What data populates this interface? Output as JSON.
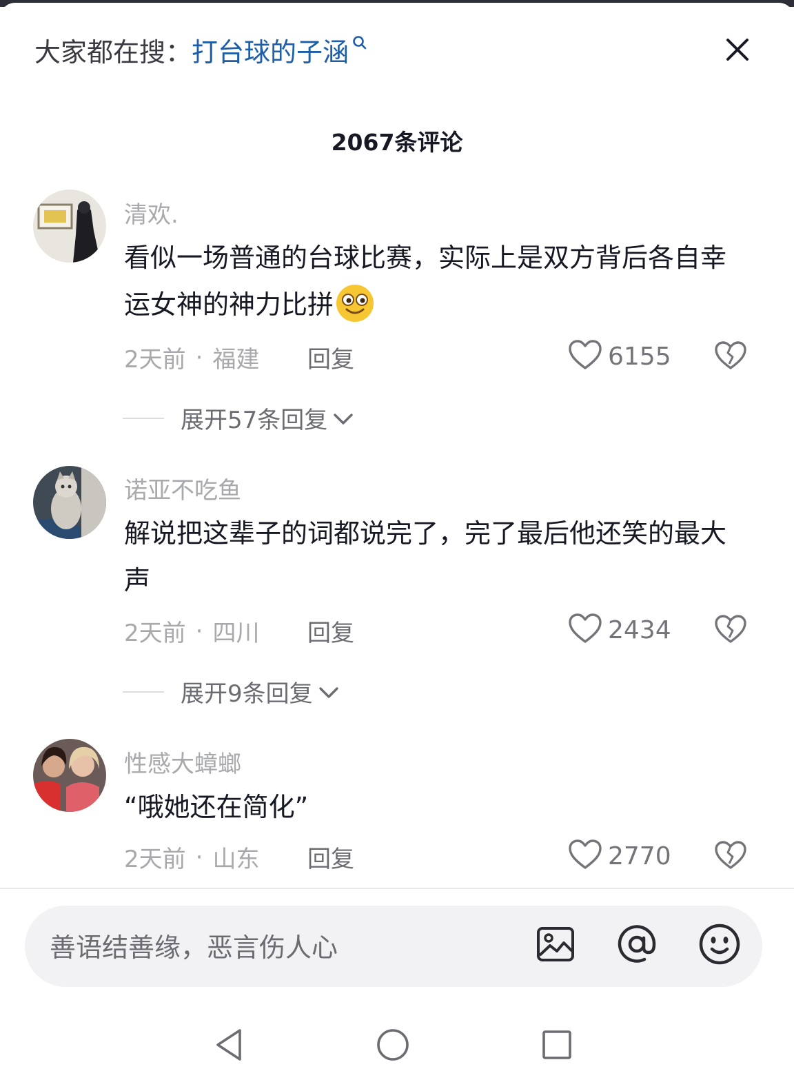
{
  "search": {
    "prefix": "大家都在搜：",
    "query": "打台球的子涵"
  },
  "comments_header": {
    "title": "2067条评论"
  },
  "input": {
    "placeholder": "善语结善缘，恶言伤人心"
  },
  "comments": [
    {
      "user": "清欢.",
      "text": "看似一场普通的台球比赛，实际上是双方背后各自幸运女神的神力比拼",
      "emoji": "grinning-face-icon",
      "time": "2天前",
      "location": "福建",
      "reply_label": "回复",
      "likes": "6155",
      "expand_label": "展开57条回复"
    },
    {
      "user": "诺亚不吃鱼",
      "text": "解说把这辈子的词都说完了，完了最后他还笑的最大声",
      "time": "2天前",
      "location": "四川",
      "reply_label": "回复",
      "likes": "2434",
      "expand_label": "展开9条回复"
    },
    {
      "user": "性感大蟑螂",
      "text": "“哦她还在简化”",
      "time": "2天前",
      "location": "山东",
      "reply_label": "回复",
      "likes": "2770"
    }
  ],
  "colors": {
    "link": "#1c5ea8",
    "secondary_text": "#a8a9ad",
    "input_bg": "#f2f2f4"
  },
  "icons": [
    "search-icon",
    "close-icon",
    "heart-icon",
    "broken-heart-icon",
    "chevron-down-icon",
    "image-icon",
    "at-icon",
    "smiley-icon",
    "back-icon",
    "home-icon",
    "recents-icon"
  ]
}
